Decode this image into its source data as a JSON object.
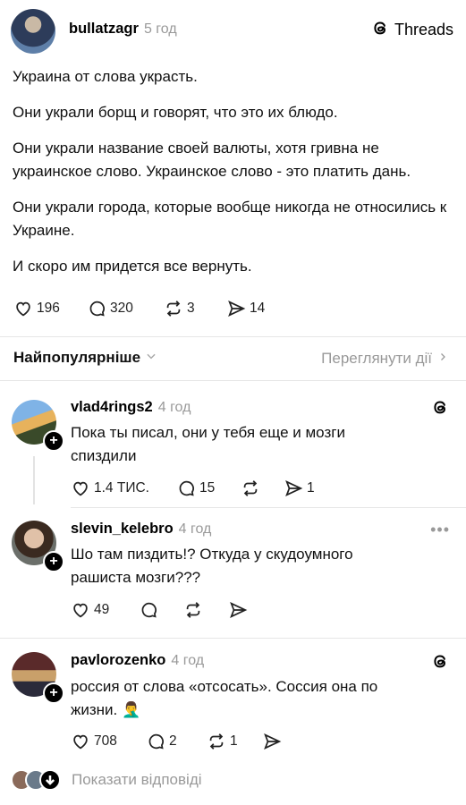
{
  "post": {
    "username": "bullatzagr",
    "time": "5 год",
    "brand": "Threads",
    "paragraphs": [
      "Украина от слова украсть.",
      "Они украли борщ и говорят, что это их блюдо.",
      "Они украли название своей валюты, хотя гривна не украинское слово. Украинское слово - это платить дань.",
      "Они украли города, которые вообще никогда не относились к Украине.",
      "И скоро им придется все вернуть."
    ],
    "likes": "196",
    "comments": "320",
    "reposts": "3",
    "shares": "14"
  },
  "sort": {
    "label": "Найпопулярніше",
    "view_activity": "Переглянути дії"
  },
  "replies": [
    {
      "username": "vlad4rings2",
      "time": "4 год",
      "text": "Пока ты писал, они у тебя еще и мозги спиздили",
      "likes": "1.4 ТИС.",
      "comments": "15",
      "reposts": "",
      "shares": "1"
    },
    {
      "username": "slevin_kelebro",
      "time": "4 год",
      "text": "Шо там пиздить!? Откуда у скудоумного рашиста мозги???",
      "likes": "49",
      "comments": "",
      "reposts": "",
      "shares": ""
    },
    {
      "username": "pavlorozenko",
      "time": "4 год",
      "text": "россия от слова «отсосать». Соссия она по жизни. 🤦‍♂️",
      "likes": "708",
      "comments": "2",
      "reposts": "1",
      "shares": ""
    }
  ],
  "show_replies": "Показати відповіді",
  "icons": [
    "heart-icon",
    "comment-icon",
    "repost-icon",
    "share-icon",
    "threads-logo-icon",
    "chevron-down-icon",
    "chevron-right-icon",
    "more-icon",
    "plus-icon"
  ]
}
